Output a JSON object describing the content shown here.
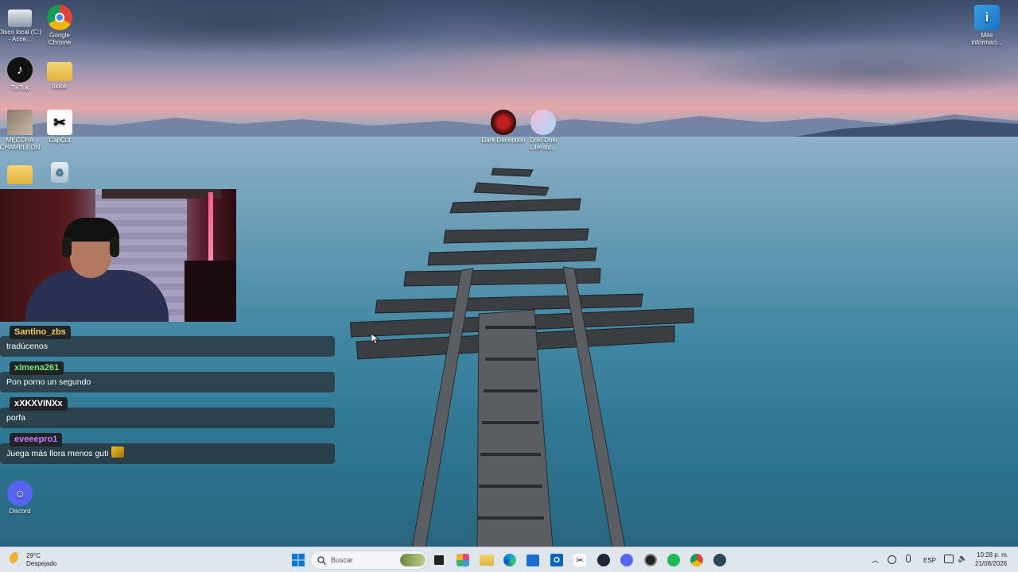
{
  "desktop": {
    "icons": [
      {
        "label": "Disco local (C:) - Acce...",
        "icon": "drive-icon"
      },
      {
        "label": "Google Chrome",
        "icon": "chrome-icon"
      },
      {
        "label": "TikTok",
        "icon": "tiktok-icon"
      },
      {
        "label": "tiktok",
        "icon": "folder-icon"
      },
      {
        "label": "MECCHA CHAMELEON",
        "icon": "game-icon"
      },
      {
        "label": "CapCut",
        "icon": "capcut-icon"
      },
      {
        "label": "",
        "icon": "folder-icon"
      },
      {
        "label": "",
        "icon": "recycle-bin-icon"
      },
      {
        "label": "Dark Deception",
        "icon": "dark-deception-icon"
      },
      {
        "label": "Doki Doki Literatu...",
        "icon": "ddlc-icon"
      },
      {
        "label": "Más informaci...",
        "icon": "info-icon"
      },
      {
        "label": "Discord",
        "icon": "discord-icon"
      }
    ]
  },
  "chat": {
    "messages": [
      {
        "user": "Santino_zbs",
        "text": "tradúcenos",
        "color": "#f0d060"
      },
      {
        "user": "ximena261",
        "text": "Pon porno un segundo",
        "color": "#7ee87e"
      },
      {
        "user": "xXKXVINXx",
        "text": "porfa",
        "color": "#ffffff"
      },
      {
        "user": "eveeepro1",
        "text": "Juega más llora menos guti",
        "color": "#c77dff"
      }
    ]
  },
  "taskbar": {
    "weather_temp": "29°C",
    "weather_desc": "Despejado",
    "search_placeholder": "Buscar",
    "language": "ESP",
    "time": "10:28 p. m.",
    "date": "21/08/2026"
  }
}
